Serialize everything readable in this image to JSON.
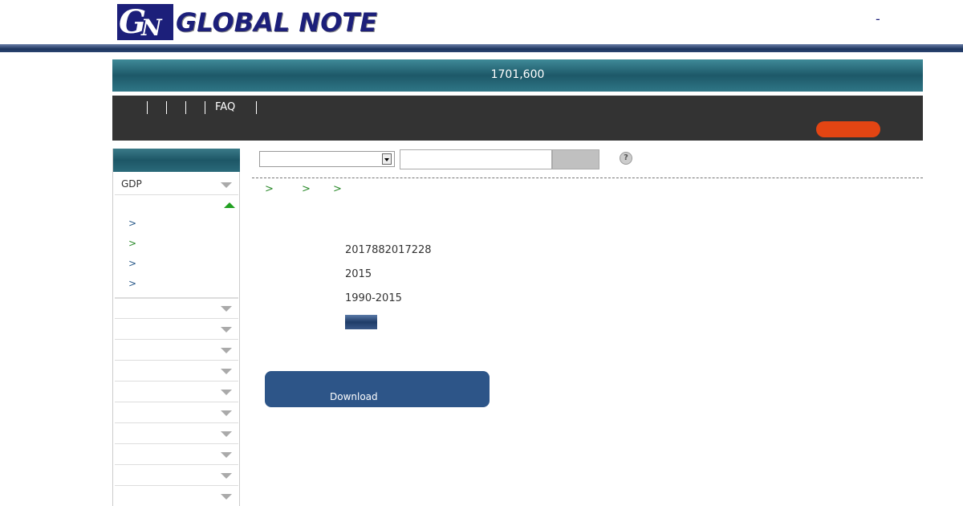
{
  "header": {
    "logo_letters": "GN",
    "logo_text": "GLOBAL NOTE",
    "top_right": "-"
  },
  "banner": {
    "text": "1701,600"
  },
  "nav": {
    "faq": "FAQ"
  },
  "sidebar": {
    "gdp_label": "GDP",
    "sub_links": [
      ">",
      ">",
      ">",
      ">"
    ],
    "collapsed_rows": 10
  },
  "search": {
    "input_value": "",
    "help_icon": "?"
  },
  "breadcrumb": [
    ">",
    ">",
    ">"
  ],
  "info": {
    "line1": "2017882017228",
    "line2": "2015",
    "line3": "1990-2015"
  },
  "download": {
    "label": "Download"
  },
  "colors": {
    "brand_navy": "#1c1f7a",
    "banner_teal": "#1d5868",
    "nav_dark": "#333333",
    "accent_orange": "#e34513",
    "link_green": "#2a8a2a",
    "download_blue": "#2d5588"
  }
}
